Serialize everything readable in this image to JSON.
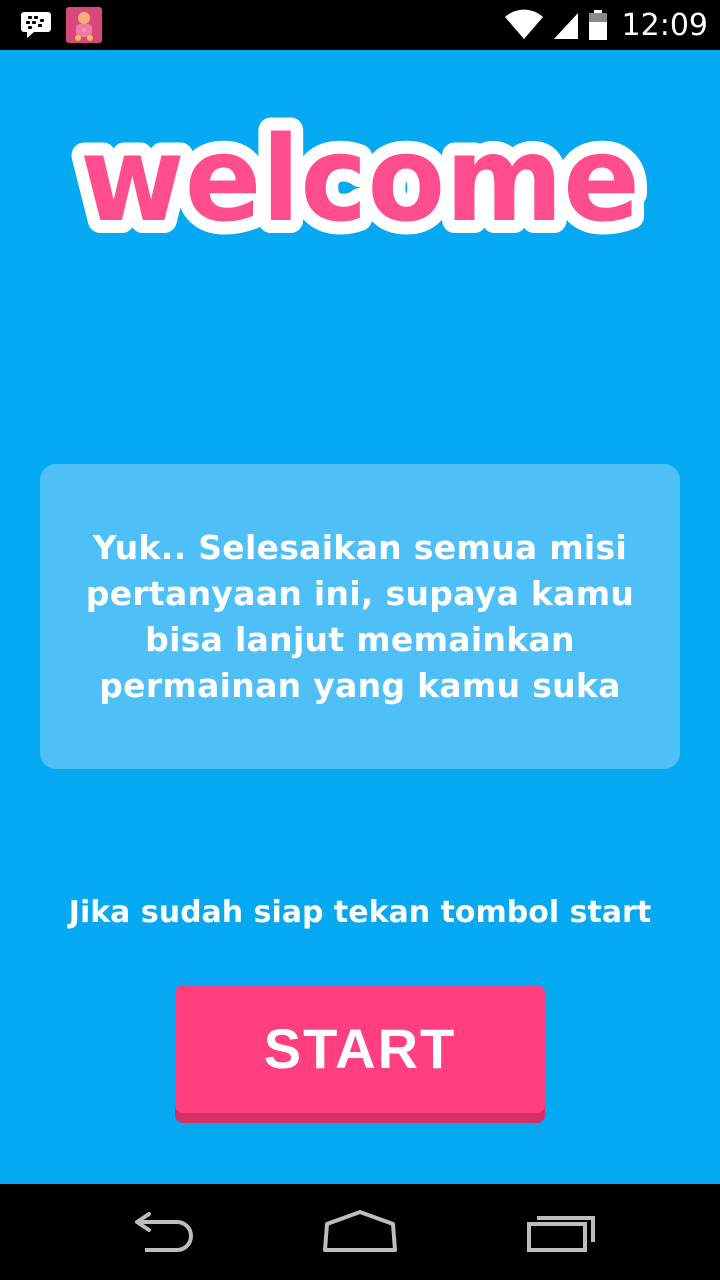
{
  "status_bar": {
    "time": "12:09",
    "icons": [
      "bbm-icon",
      "app-notification-icon",
      "wifi-icon",
      "signal-icon",
      "battery-icon"
    ]
  },
  "welcome": {
    "title": "welcome",
    "fill_color": "#ff4d8d",
    "outline_color": "#ffffff"
  },
  "message": {
    "text": "Yuk.. Selesaikan semua misi pertanyaan ini, supaya kamu bisa lanjut memainkan permainan yang kamu suka"
  },
  "prompt": {
    "text": "Jika sudah siap tekan tombol start"
  },
  "start_button": {
    "label": "START",
    "color": "#ff3f7f"
  },
  "navigation": {
    "buttons": [
      "back-icon",
      "home-icon",
      "recent-apps-icon"
    ]
  },
  "colors": {
    "background": "#05a9f2",
    "card": "#4ec0f7"
  }
}
